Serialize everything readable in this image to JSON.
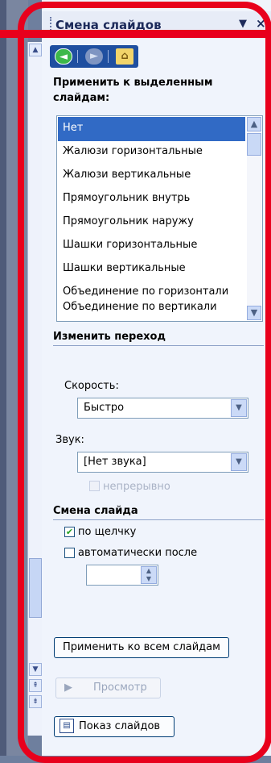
{
  "pane": {
    "title": "Смена слайдов",
    "menu_arrow": "▼",
    "close": "×"
  },
  "nav": {
    "back": "◄",
    "forward": "►",
    "home": "⌂"
  },
  "apply_section": {
    "heading_line1": "Применить к выделенным",
    "heading_line2": "слайдам:"
  },
  "transitions": {
    "selected": "Нет",
    "items": [
      "Нет",
      "Жалюзи горизонтальные",
      "Жалюзи вертикальные",
      "Прямоугольник внутрь",
      "Прямоугольник наружу",
      "Шашки горизонтальные",
      "Шашки вертикальные",
      "Объединение по горизонтали",
      "Объединение по вертикали"
    ]
  },
  "modify_section": {
    "heading": "Изменить переход",
    "speed_label": "Скорость:",
    "speed_value": "Быстро",
    "sound_label": "Звук:",
    "sound_value": "[Нет звука]",
    "loop_label": "непрерывно"
  },
  "advance_section": {
    "heading": "Смена слайда",
    "on_click_label": "по щелчку",
    "on_click_checked": true,
    "auto_label": "автоматически после",
    "auto_checked": false,
    "auto_value": ""
  },
  "buttons": {
    "apply_all": "Применить ко всем слайдам",
    "preview": "Просмотр",
    "slideshow": "Показ слайдов"
  },
  "colors": {
    "annotation": "#e8001c",
    "selection": "#316ac5",
    "pane_background": "#f0f4fc"
  }
}
